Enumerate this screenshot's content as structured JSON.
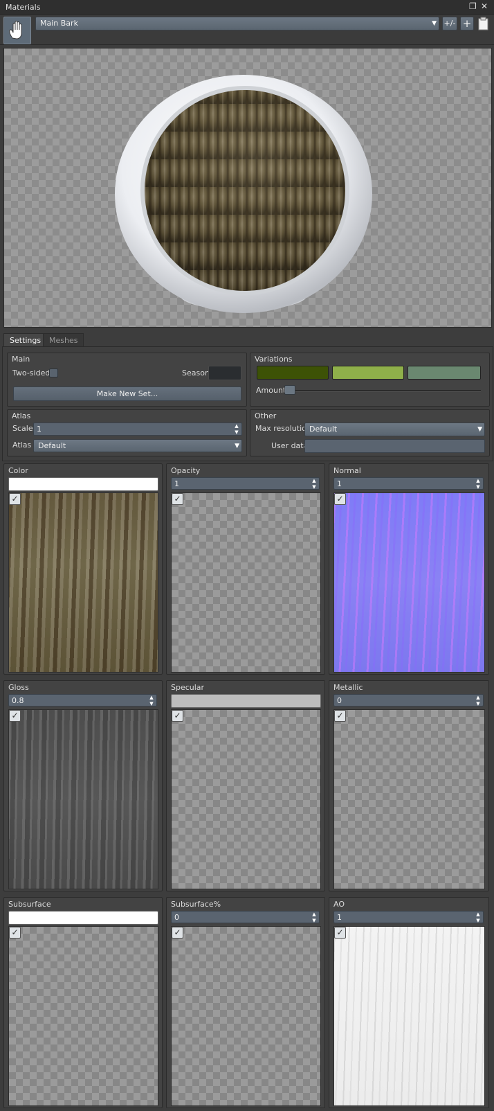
{
  "window": {
    "title": "Materials",
    "restore_icon": "restore-icon",
    "close_icon": "close-icon"
  },
  "toolbar": {
    "material_name": "Main Bark",
    "plus_minus_label": "+/-",
    "add_icon": "add-icon",
    "paste_icon": "clipboard-icon"
  },
  "tabs": [
    {
      "label": "Settings",
      "active": true
    },
    {
      "label": "Meshes",
      "active": false
    }
  ],
  "main": {
    "title": "Main",
    "two_sided_label": "Two-sided",
    "two_sided_checked": false,
    "season_label": "Season",
    "season_color": "#2a2d30",
    "make_new_set_label": "Make New Set..."
  },
  "variations": {
    "title": "Variations",
    "colors": [
      "#3d5206",
      "#8fb04a",
      "#6a8870"
    ],
    "amount_label": "Amount",
    "amount_value": 0
  },
  "atlas": {
    "title": "Atlas",
    "scale_label": "Scale",
    "scale_value": "1",
    "atlas_label": "Atlas",
    "atlas_value": "Default"
  },
  "other": {
    "title": "Other",
    "max_resolution_label": "Max resolution",
    "max_resolution_value": "Default",
    "user_data_label": "User data",
    "user_data_value": ""
  },
  "channels": [
    {
      "label": "Color",
      "field_type": "color",
      "value": "#ffffff",
      "enabled": true,
      "texture": "bark"
    },
    {
      "label": "Opacity",
      "field_type": "spin",
      "value": "1",
      "enabled": true,
      "texture": "none"
    },
    {
      "label": "Normal",
      "field_type": "spin",
      "value": "1",
      "enabled": true,
      "texture": "normal"
    },
    {
      "label": "Gloss",
      "field_type": "spin",
      "value": "0.8",
      "enabled": true,
      "texture": "gloss"
    },
    {
      "label": "Specular",
      "field_type": "color",
      "value": "#bdbdbd",
      "enabled": true,
      "texture": "none"
    },
    {
      "label": "Metallic",
      "field_type": "spin",
      "value": "0",
      "enabled": true,
      "texture": "none"
    },
    {
      "label": "Subsurface",
      "field_type": "color",
      "value": "#ffffff",
      "enabled": true,
      "texture": "none"
    },
    {
      "label": "Subsurface%",
      "field_type": "spin",
      "value": "0",
      "enabled": true,
      "texture": "none"
    },
    {
      "label": "AO",
      "field_type": "spin",
      "value": "1",
      "enabled": true,
      "texture": "ao"
    }
  ]
}
